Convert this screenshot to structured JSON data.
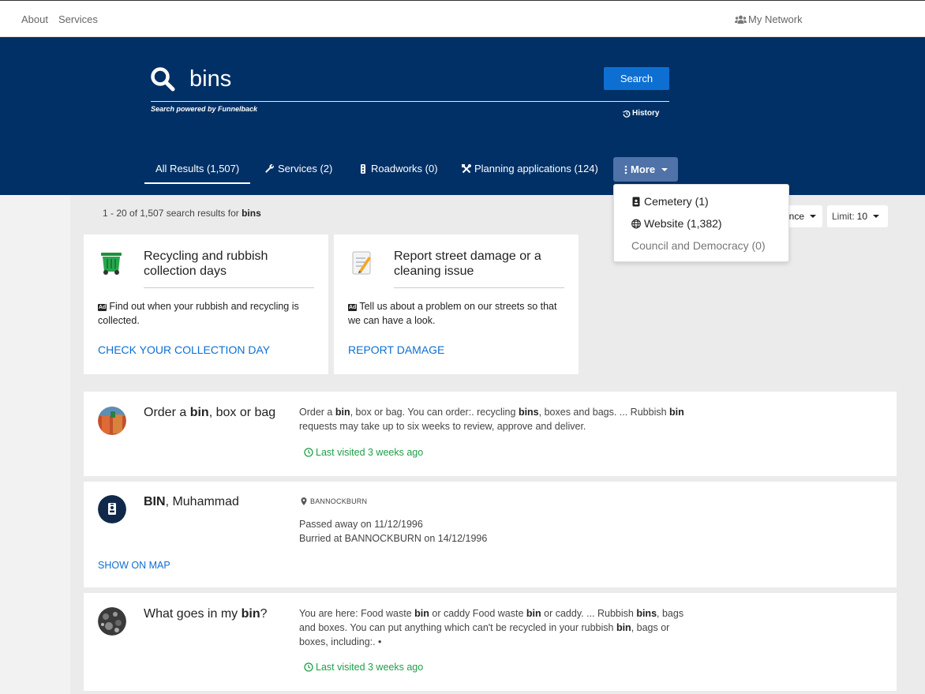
{
  "topbar": {
    "about": "About",
    "services": "Services",
    "my_network": "My Network"
  },
  "search": {
    "query": "bins",
    "button": "Search",
    "powered_by": "Search powered by Funnelback",
    "history": "History"
  },
  "tabs": {
    "all": "All Results (1,507)",
    "services": "Services (2)",
    "roadworks": "Roadworks (0)",
    "planning": "Planning applications (124)",
    "more": "More"
  },
  "more_menu": {
    "cemetery": "Cemetery (1)",
    "website": "Website (1,382)",
    "council": "Council and Democracy (0)"
  },
  "results_summary": {
    "prefix": "1 - 20 of 1,507 search results for ",
    "query": "bins"
  },
  "sort": {
    "label": "nce"
  },
  "limit": {
    "label": "Limit:",
    "value": "10"
  },
  "promos": [
    {
      "title": "Recycling and rubbish collection days",
      "description": "Find out when your rubbish and recycling is collected.",
      "link": "CHECK YOUR COLLECTION DAY",
      "ad_badge": "Ad"
    },
    {
      "title": "Report street damage or a cleaning issue",
      "description": "Tell us about a problem on our streets so that we can have a look.",
      "link": "REPORT DAMAGE",
      "ad_badge": "Ad"
    }
  ],
  "results": [
    {
      "title_pre": "Order a ",
      "title_bold": "bin",
      "title_post": ", box or bag",
      "summary_html": "Order a <b>bin</b>, box or bag. You can order:. recycling <b>bins</b>, boxes and bags. ... Rubbish <b>bin</b> requests may take up to six weeks to review, approve and deliver.",
      "visited": "Last visited 3 weeks ago"
    },
    {
      "title_bold": "BIN",
      "title_post": ", Muhammad",
      "location": "BANNOCKBURN",
      "line1": "Passed away on 11/12/1996",
      "line2": "Burried at BANNOCKBURN on 14/12/1996",
      "map_link": "SHOW ON MAP"
    },
    {
      "title_pre": "What goes in my ",
      "title_bold": "bin",
      "title_post": "?",
      "summary_html": "You are here: Food waste <b>bin</b> or caddy Food waste <b>bin</b> or caddy. ... Rubbish <b>bins</b>, bags and boxes. You can put anything which can't be recycled in your rubbish <b>bin</b>, bags or boxes, including:. •",
      "visited": "Last visited 3 weeks ago"
    }
  ],
  "colors": {
    "hero": "#003066",
    "accent": "#0e6fd3",
    "visited": "#1f9e48",
    "more_tab": "#4f72a8"
  }
}
